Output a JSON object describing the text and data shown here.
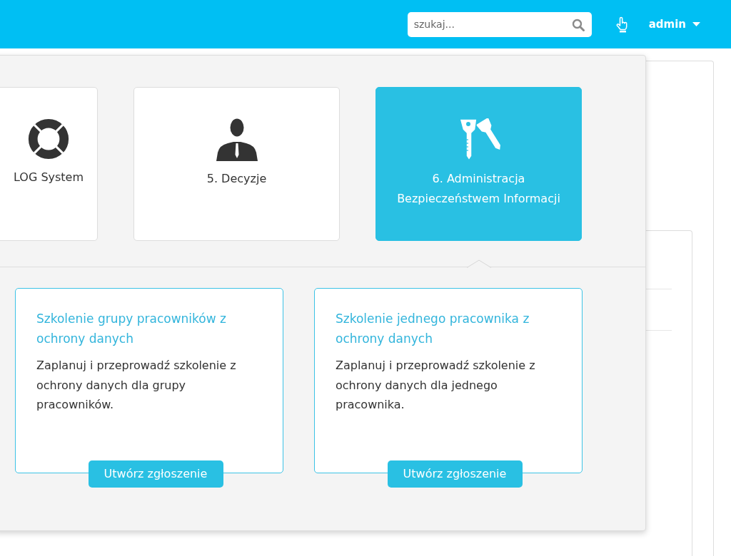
{
  "top_bar": {
    "search": {
      "placeholder": "szukaj..."
    },
    "user_menu": {
      "label": "admin"
    }
  },
  "categories": [
    {
      "label": "LOG System",
      "selected": false
    },
    {
      "label": "5. Decyzje",
      "selected": false
    },
    {
      "label": "6. Administracja Bezpieczeństwem Informacji",
      "selected": true
    }
  ],
  "services": [
    {
      "title": "Szkolenie grupy pracowników z ochrony danych",
      "description": "Zaplanuj i przeprowadź szkolenie z ochrony danych dla grupy pracowników.",
      "button": "Utwórz zgłoszenie"
    },
    {
      "title": "Szkolenie jednego pracownika z ochrony danych",
      "description": "Zaplanuj i przeprowadź szkolenie z ochrony danych dla jednego pracownika.",
      "button": "Utwórz zgłoszenie"
    }
  ]
}
